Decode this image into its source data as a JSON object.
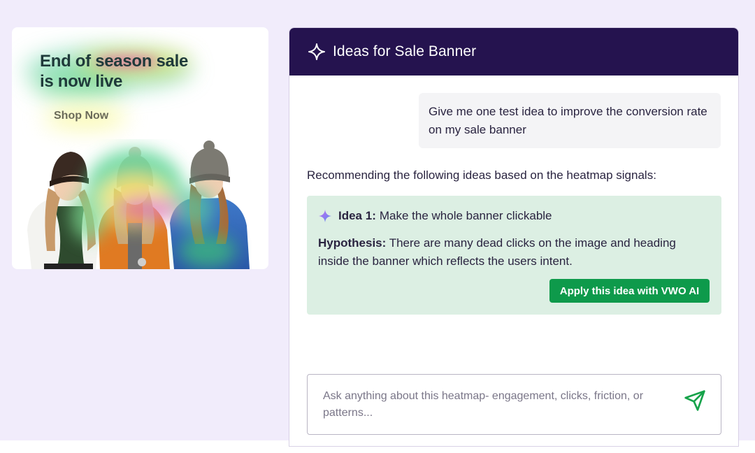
{
  "banner": {
    "heading_line1": "End of season sale",
    "heading_line2": "is now live",
    "shop_button": "Shop Now"
  },
  "panel": {
    "title": "Ideas for Sale Banner",
    "title_icon": "sparkle-icon",
    "user_message": "Give me one test idea to improve the conversion rate on my sale banner",
    "recommendation_text": "Recommending the following ideas based on the heatmap signals:",
    "idea": {
      "icon": "sparkle-gradient-icon",
      "label": "Idea 1:",
      "text": "Make the whole banner clickable",
      "hypothesis_label": "Hypothesis:",
      "hypothesis_text": "There are many dead clicks on the image and heading inside the banner which reflects the users intent.",
      "apply_button": "Apply this idea with VWO AI"
    },
    "input": {
      "placeholder": "Ask anything about this heatmap- engagement, clicks, friction, or patterns...",
      "send_icon": "send-icon"
    }
  },
  "colors": {
    "background": "#f1ecfb",
    "header": "#25134f",
    "idea_card": "#dcefe3",
    "apply_button": "#0e9a4b"
  }
}
